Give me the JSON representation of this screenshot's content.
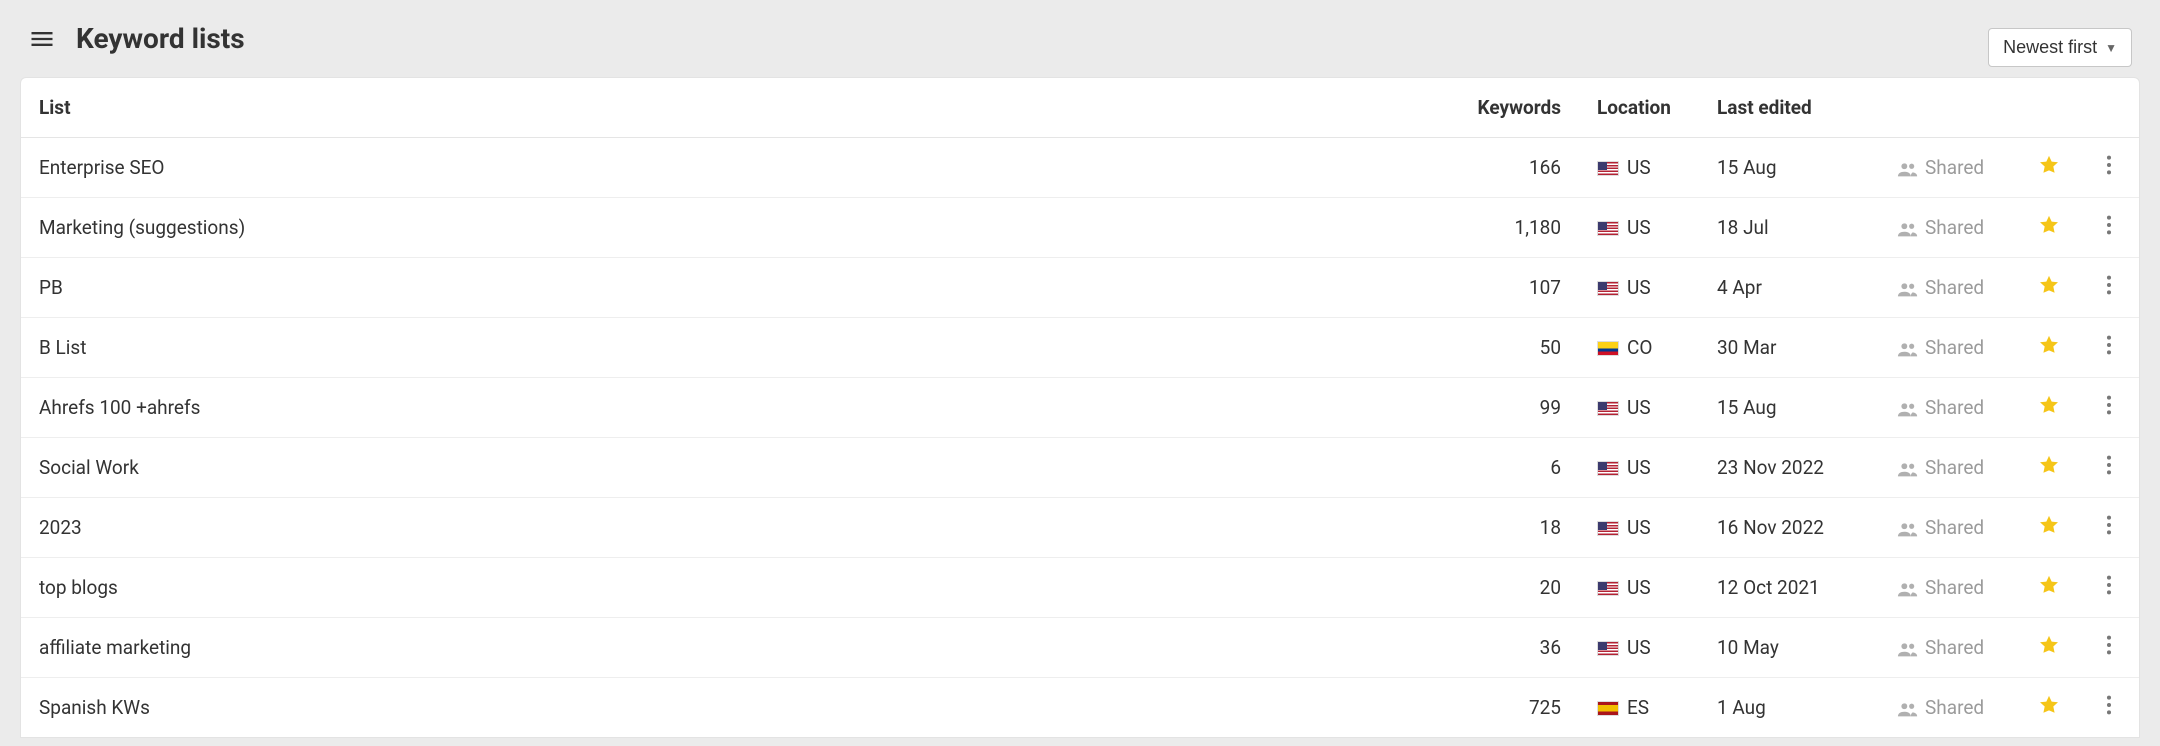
{
  "header": {
    "title": "Keyword lists",
    "sort_label": "Newest first"
  },
  "columns": {
    "list": "List",
    "keywords": "Keywords",
    "location": "Location",
    "last_edited": "Last edited"
  },
  "shared_label": "Shared",
  "rows": [
    {
      "name": "Enterprise SEO",
      "keywords": "166",
      "country_code": "US",
      "flag": "us",
      "last_edited": "15 Aug"
    },
    {
      "name": "Marketing (suggestions)",
      "keywords": "1,180",
      "country_code": "US",
      "flag": "us",
      "last_edited": "18 Jul"
    },
    {
      "name": "PB",
      "keywords": "107",
      "country_code": "US",
      "flag": "us",
      "last_edited": "4 Apr"
    },
    {
      "name": "B List",
      "keywords": "50",
      "country_code": "CO",
      "flag": "co",
      "last_edited": "30 Mar"
    },
    {
      "name": "Ahrefs 100 +ahrefs",
      "keywords": "99",
      "country_code": "US",
      "flag": "us",
      "last_edited": "15 Aug"
    },
    {
      "name": "Social Work",
      "keywords": "6",
      "country_code": "US",
      "flag": "us",
      "last_edited": "23 Nov 2022"
    },
    {
      "name": "2023",
      "keywords": "18",
      "country_code": "US",
      "flag": "us",
      "last_edited": "16 Nov 2022"
    },
    {
      "name": "top blogs",
      "keywords": "20",
      "country_code": "US",
      "flag": "us",
      "last_edited": "12 Oct 2021"
    },
    {
      "name": "affiliate marketing",
      "keywords": "36",
      "country_code": "US",
      "flag": "us",
      "last_edited": "10 May"
    },
    {
      "name": "Spanish KWs",
      "keywords": "725",
      "country_code": "ES",
      "flag": "es",
      "last_edited": "1 Aug"
    }
  ]
}
